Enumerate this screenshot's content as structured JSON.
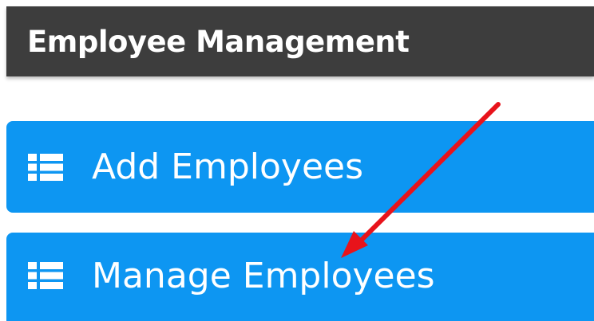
{
  "header": {
    "title": "Employee Management",
    "background": "#3d3d3d"
  },
  "menu": {
    "accent": "#0d96f2",
    "items": [
      {
        "label": "Add Employees",
        "icon": "list-icon"
      },
      {
        "label": "Manage Employees",
        "icon": "list-icon"
      }
    ]
  },
  "annotation": {
    "type": "arrow",
    "color": "#e8131b",
    "points_to": "Manage Employees"
  }
}
